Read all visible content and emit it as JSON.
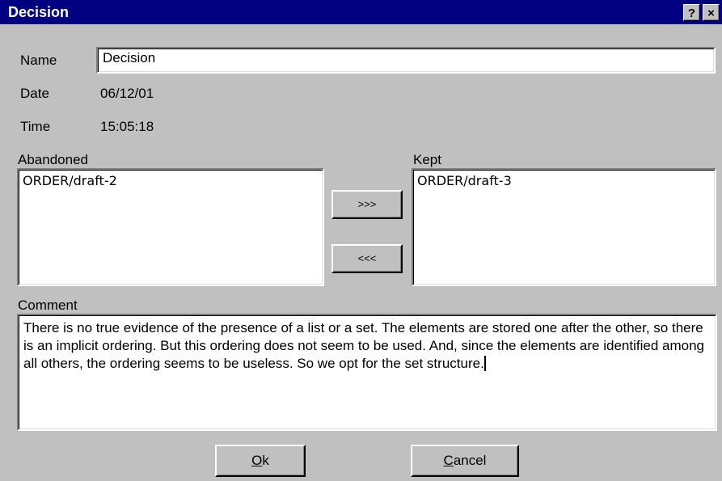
{
  "window": {
    "title": "Decision",
    "help_button": "?",
    "close_button": "×"
  },
  "fields": {
    "name_label": "Name",
    "name_value": "Decision",
    "date_label": "Date",
    "date_value": "06/12/01",
    "time_label": "Time",
    "time_value": "15:05:18"
  },
  "abandoned": {
    "label": "Abandoned",
    "items": [
      "ORDER/draft-2"
    ]
  },
  "kept": {
    "label": "Kept",
    "items": [
      "ORDER/draft-3"
    ]
  },
  "transfer": {
    "move_right_label": ">>>",
    "move_left_label": "<<<"
  },
  "comment": {
    "label": "Comment",
    "text": "There is no true evidence of the presence of a list or a set. The elements are stored one after the other, so there is an implicit ordering. But this ordering does not seem to be used. And, since the elements are identified among all others, the ordering seems to be useless. So we opt for the set structure."
  },
  "buttons": {
    "ok_mnemonic": "O",
    "ok_rest": "k",
    "cancel_mnemonic": "C",
    "cancel_rest": "ancel"
  }
}
